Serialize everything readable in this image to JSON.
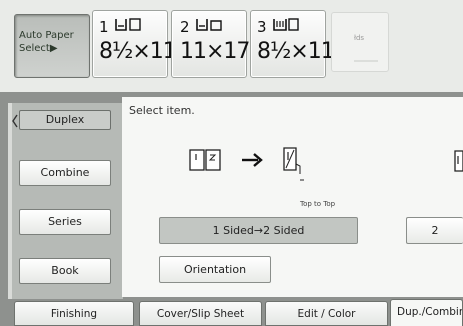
{
  "paper_trays": {
    "auto_select": {
      "line1": "Auto Paper",
      "line2": "Select▶"
    },
    "trays": [
      {
        "number": "1",
        "size": "8½×11"
      },
      {
        "number": "2",
        "size": "11×17"
      },
      {
        "number": "3",
        "size": "8½×11"
      }
    ],
    "partial_tray": {
      "label": "łds"
    }
  },
  "side_menu": {
    "items": [
      {
        "label": "Duplex",
        "selected": true
      },
      {
        "label": "Combine",
        "selected": false
      },
      {
        "label": "Series",
        "selected": false
      },
      {
        "label": "Book",
        "selected": false
      }
    ]
  },
  "main": {
    "instruction": "Select item.",
    "diagram": {
      "orient_note": "Top to Top"
    },
    "options": {
      "one_to_two": "1 Sided→2 Sided",
      "partial_right": "2",
      "orientation": "Orientation"
    }
  },
  "bottom_tabs": [
    {
      "label": "Finishing"
    },
    {
      "label": "Cover/Slip Sheet"
    },
    {
      "label": "Edit / Color"
    },
    {
      "label": "Dup./Combine"
    }
  ],
  "colors": {
    "background": "#8e918e",
    "panel": "#f6f7f5",
    "selected_button": "#c2c6c2"
  }
}
